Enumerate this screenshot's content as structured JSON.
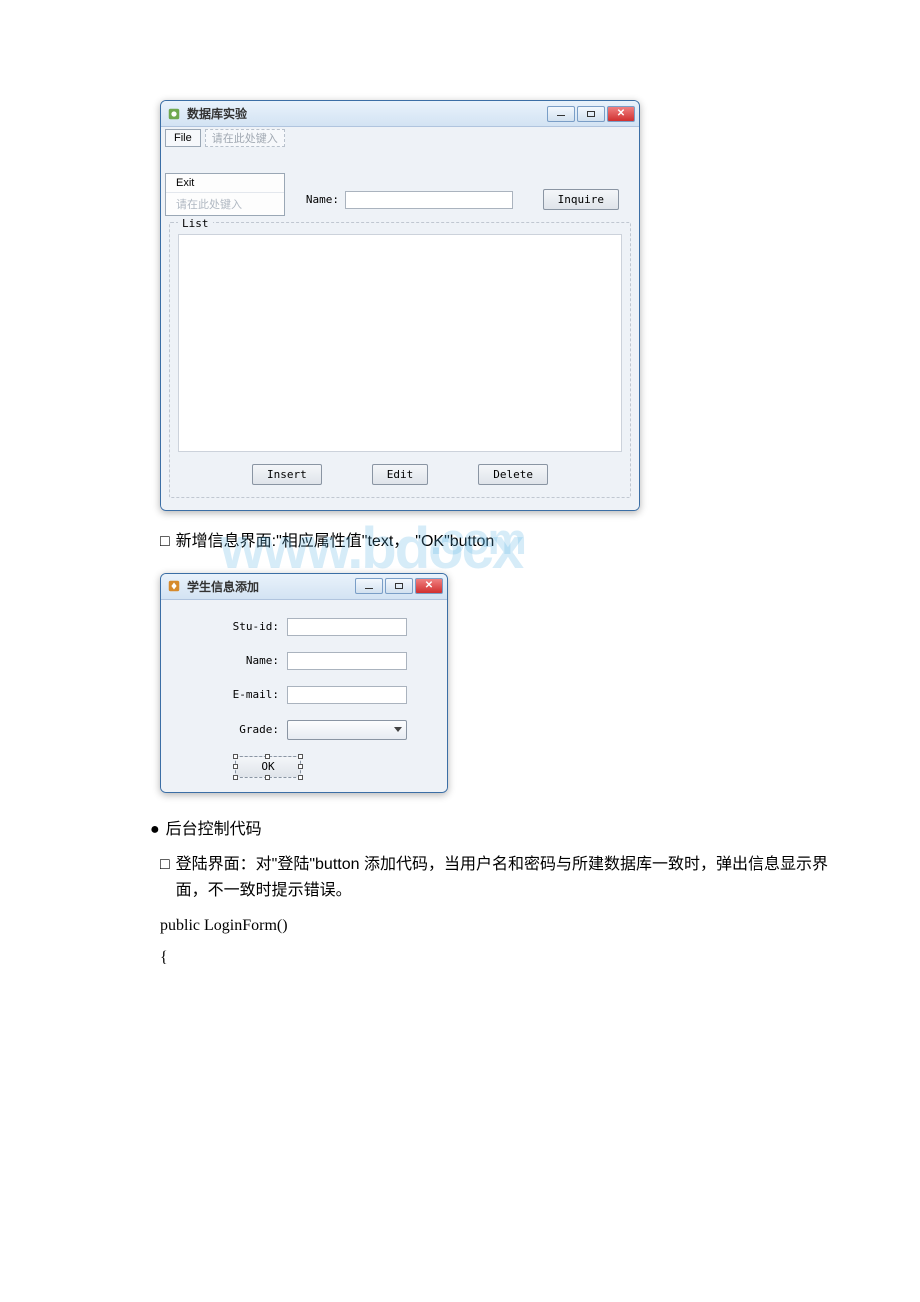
{
  "window1": {
    "title": "数据库实验",
    "menu": {
      "file": "File",
      "ghost_main": "请在此处键入",
      "dropdown": {
        "exit": "Exit",
        "ghost": "请在此处键入"
      }
    },
    "query": {
      "name_label": "Name:",
      "inquire_btn": "Inquire"
    },
    "list_group_title": "List",
    "buttons": {
      "insert": "Insert",
      "edit": "Edit",
      "delete": "Delete"
    }
  },
  "caption1": {
    "bullet": "□",
    "text_a": "新增信息界面:\"相应属性值\"text，",
    "text_b": "\"OK\"button"
  },
  "watermark": {
    "left": "www.bdocx",
    "right": ".com"
  },
  "window2": {
    "title": "学生信息添加",
    "fields": {
      "stuid": "Stu-id:",
      "name": "Name:",
      "email": "E-mail:",
      "grade": "Grade:"
    },
    "ok_btn": "OK"
  },
  "section_heading": {
    "bullet": "●",
    "text": "后台控制代码"
  },
  "paragraph": {
    "bullet": "□",
    "text": "登陆界面：对\"登陆\"button 添加代码，当用户名和密码与所建数据库一致时，弹出信息显示界面，不一致时提示错误。"
  },
  "code": {
    "line1": "public LoginForm()",
    "line2": "{"
  }
}
